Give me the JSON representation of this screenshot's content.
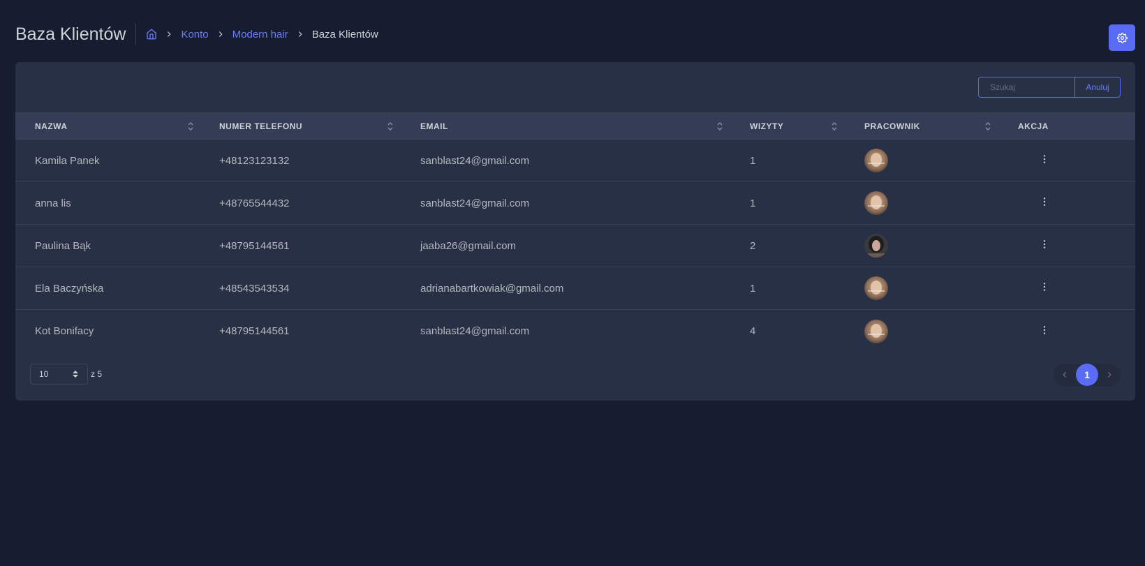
{
  "header": {
    "title": "Baza Klientów",
    "breadcrumb": {
      "home_icon": "home-icon",
      "items": [
        "Konto",
        "Modern hair"
      ],
      "current": "Baza Klientów"
    },
    "settings_icon": "gear-icon"
  },
  "search": {
    "placeholder": "Szukaj",
    "value": "",
    "cancel_label": "Anuluj"
  },
  "table": {
    "columns": [
      "NAZWA",
      "NUMER TELEFONU",
      "EMAIL",
      "WIZYTY",
      "PRACOWNIK",
      "AKCJA"
    ],
    "rows": [
      {
        "name": "Kamila Panek",
        "phone": "+48123123132",
        "email": "sanblast24@gmail.com",
        "visits": "1",
        "employee_avatar": "avatar-a"
      },
      {
        "name": "anna lis",
        "phone": "+48765544432",
        "email": "sanblast24@gmail.com",
        "visits": "1",
        "employee_avatar": "avatar-a"
      },
      {
        "name": "Paulina Bąk",
        "phone": "+48795144561",
        "email": "jaaba26@gmail.com",
        "visits": "2",
        "employee_avatar": "avatar-b"
      },
      {
        "name": "Ela Baczyńska",
        "phone": "+48543543534",
        "email": "adrianabartkowiak@gmail.com",
        "visits": "1",
        "employee_avatar": "avatar-a"
      },
      {
        "name": "Kot Bonifacy",
        "phone": "+48795144561",
        "email": "sanblast24@gmail.com",
        "visits": "4",
        "employee_avatar": "avatar-a"
      }
    ]
  },
  "footer": {
    "page_size": "10",
    "of_total": "z 5",
    "current_page": "1"
  },
  "colors": {
    "background": "#161d31",
    "card": "#283046",
    "accent": "#5a6cf6"
  }
}
